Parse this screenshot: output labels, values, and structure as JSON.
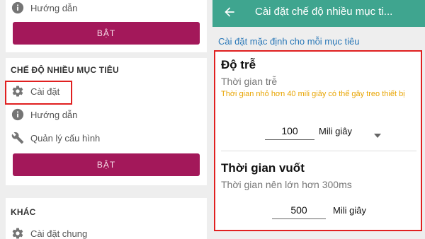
{
  "left": {
    "card1": {
      "help_label": "Hướng dẫn",
      "button_label": "BẬT"
    },
    "card2": {
      "section_title": "CHẾ ĐỘ NHIỀU MỤC TIÊU",
      "settings_label": "Cài đặt",
      "help_label": "Hướng dẫn",
      "config_label": "Quản lý cấu hình",
      "button_label": "BẬT"
    },
    "card3": {
      "section_title": "KHÁC",
      "general_label": "Cài đặt chung"
    }
  },
  "right": {
    "title": "Cài đặt chế độ nhiều mục ti...",
    "subheader": "Cài đặt mặc định cho mỗi mục tiêu",
    "delay": {
      "heading": "Độ trễ",
      "subtitle": "Thời gian trễ",
      "warning": "Thời gian nhỏ hơn 40 mili giây có thể gây treo thiết bị",
      "value": "100",
      "unit": "Mili giây"
    },
    "swipe": {
      "heading": "Thời gian vuốt",
      "subtitle": "Thời gian nên lớn hơn 300ms",
      "value": "500",
      "unit": "Mili giây"
    }
  },
  "colors": {
    "accent_button": "#a3185a",
    "app_bar": "#3fa58f",
    "link_blue": "#2a78b8",
    "warning": "#e8a400",
    "highlight": "#e02020"
  },
  "icons": [
    "info-icon",
    "gear-icon",
    "wrench-icon",
    "back-arrow-icon",
    "dropdown-arrow-icon"
  ]
}
